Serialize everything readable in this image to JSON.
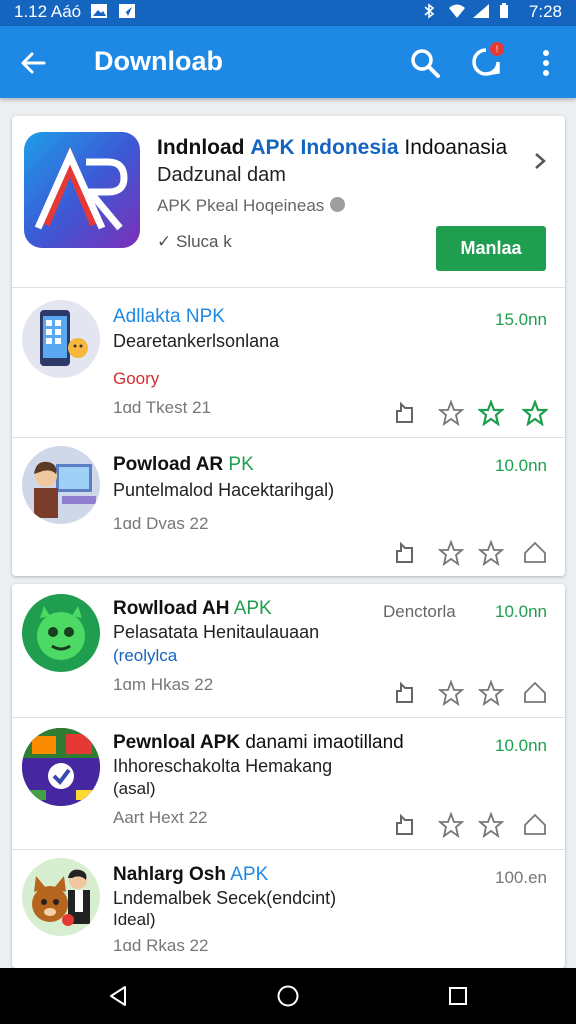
{
  "status_bar": {
    "time_left": "1.12 Aáó",
    "time_right": "7:28",
    "left_icons": [
      "image-icon",
      "send-icon"
    ],
    "right_icons": [
      "bluetooth-icon",
      "wifi-icon",
      "signal-icon",
      "battery-icon"
    ]
  },
  "app_bar": {
    "title": "Downloab",
    "badge": "!",
    "icons": [
      "back-arrow-icon",
      "search-icon",
      "notification-icon",
      "more-vert-icon"
    ]
  },
  "featured": {
    "title_part1": "Indnload",
    "title_part2": "APK Indonesia",
    "title_part3": "Indoanasia",
    "subtitle": "Dadzunal dam",
    "developer": "APK Pkeal Hoqeineas",
    "status": "✓ Sluca k",
    "install_label": "Manlaa",
    "colors": {
      "accent": "#1e88e5",
      "install": "#1e9e4e"
    }
  },
  "list": [
    {
      "title_blue": "Adllakta NPK",
      "desc": "Dearetankerlsonlana",
      "tag": "Goory",
      "tag_color": "#d32f2f",
      "date": "1ɑd Tkest 21",
      "size": "15.0nn",
      "avatar": "phone-apps"
    },
    {
      "title_bold": "Powload AR",
      "title_green": "PK",
      "desc": "Puntelmalod Hacektarihgal)",
      "date": "1ɑd Dvas 22",
      "size": "10.0nn",
      "avatar": "person-computer"
    },
    {
      "title_bold": "Rowlload AH",
      "title_green": "APK",
      "category": "Denctorla",
      "desc": "Pelasatata Henitaulauaan",
      "tag": "(reolylca",
      "tag_color": "#1565c0",
      "date": "1ɑm Hkas 22",
      "size": "10.0nn",
      "avatar": "green-monster"
    },
    {
      "title_bold": "Pewnloal APK",
      "title_rest": "danami imaotilland",
      "desc": "Ihhoreschakolta Hemakang",
      "tag": "(asal)",
      "tag_color": "#222222",
      "date": "Aart Hext 22",
      "size": "10.0nn",
      "avatar": "game-apps"
    },
    {
      "title_bold": "Nahlarg Osh",
      "title_blue": "APK",
      "desc": "Lndemalbek Secek(endcint)",
      "tag": "Ideal)",
      "tag_color": "#222222",
      "date": "1ɑd Rkas 22",
      "size": "100.en",
      "size_gray": true,
      "avatar": "dog-person"
    }
  ],
  "nav_bar": {
    "icons": [
      "back-triangle-icon",
      "home-circle-icon",
      "recents-square-icon"
    ]
  }
}
